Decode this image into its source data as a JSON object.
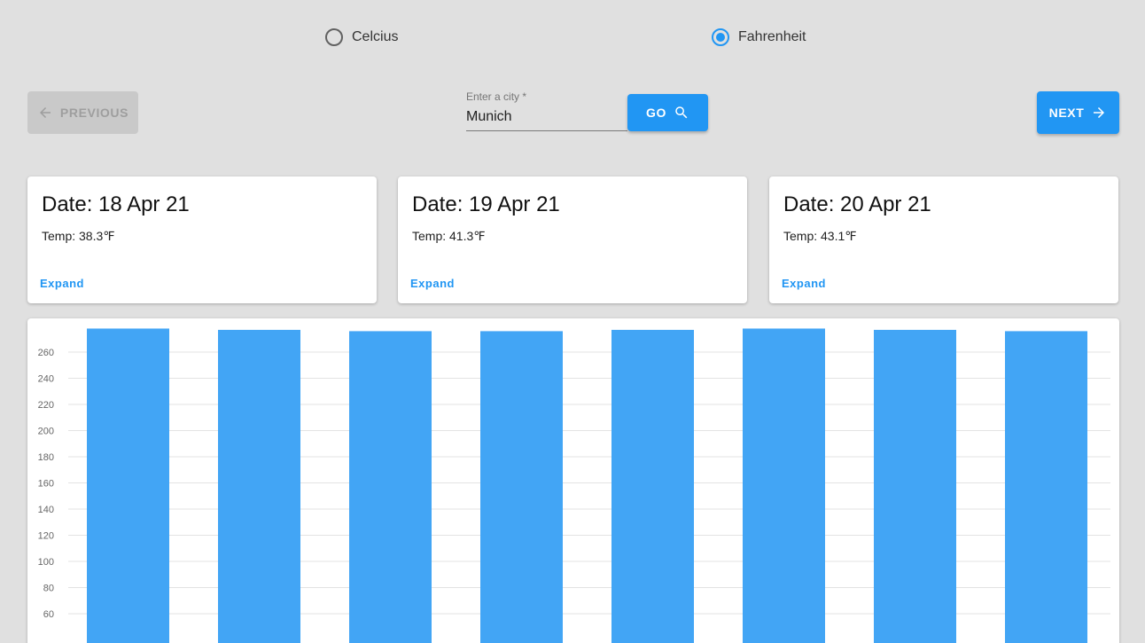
{
  "units": {
    "options": [
      {
        "label": "Celcius",
        "checked": false
      },
      {
        "label": "Fahrenheit",
        "checked": true
      }
    ]
  },
  "nav": {
    "previous_label": "Previous",
    "next_label": "Next",
    "previous_disabled": true
  },
  "search": {
    "label": "Enter a city *",
    "value": "Munich",
    "go_label": "Go"
  },
  "cards": [
    {
      "date": "Date: 18 Apr 21",
      "temp": "Temp: 38.3℉",
      "expand": "Expand"
    },
    {
      "date": "Date: 19 Apr 21",
      "temp": "Temp: 41.3℉",
      "expand": "Expand"
    },
    {
      "date": "Date: 20 Apr 21",
      "temp": "Temp: 43.1℉",
      "expand": "Expand"
    }
  ],
  "colors": {
    "accent": "#2196f3",
    "bar": "#42a5f5",
    "disabled_bg": "#c9c9c9",
    "disabled_text": "#9e9e9e",
    "background": "#e0e0e0"
  },
  "icons": {
    "previous": "arrow-left-icon",
    "next": "arrow-right-icon",
    "go": "search-icon"
  },
  "chart_data": {
    "type": "bar",
    "categories": [
      "",
      "",
      "",
      "",
      "",
      "",
      "",
      ""
    ],
    "values": [
      278,
      277,
      276,
      276,
      277,
      278,
      277,
      276
    ],
    "yticks": [
      60,
      80,
      100,
      120,
      140,
      160,
      180,
      200,
      220,
      240,
      260
    ],
    "ylim": [
      60,
      280
    ],
    "grid": true
  }
}
